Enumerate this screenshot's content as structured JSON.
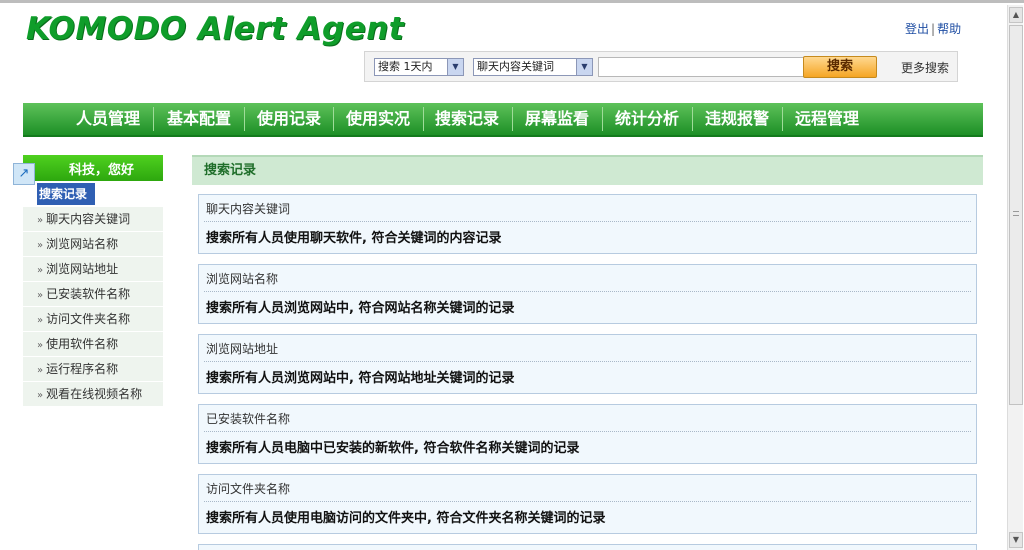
{
  "header": {
    "logo": "KOMODO Alert Agent",
    "links": [
      {
        "label": "登出"
      },
      {
        "label": "帮助"
      }
    ],
    "link_separator": "|"
  },
  "search": {
    "range_select": "搜索 1天内",
    "type_select": "聊天内容关键词",
    "keyword_value": "",
    "button_label": "搜索",
    "more_label": "更多搜索"
  },
  "nav": {
    "items": [
      {
        "label": "人员管理"
      },
      {
        "label": "基本配置"
      },
      {
        "label": "使用记录"
      },
      {
        "label": "使用实况"
      },
      {
        "label": "搜索记录"
      },
      {
        "label": "屏幕监看"
      },
      {
        "label": "统计分析"
      },
      {
        "label": "违规报警"
      },
      {
        "label": "远程管理"
      }
    ]
  },
  "sidebar": {
    "greeting": "科技，您好",
    "active": "搜索记录",
    "items": [
      {
        "label": "聊天内容关键词"
      },
      {
        "label": "浏览网站名称"
      },
      {
        "label": "浏览网站地址"
      },
      {
        "label": "已安装软件名称"
      },
      {
        "label": "访问文件夹名称"
      },
      {
        "label": "使用软件名称"
      },
      {
        "label": "运行程序名称"
      },
      {
        "label": "观看在线视频名称"
      }
    ]
  },
  "content": {
    "title": "搜索记录",
    "cards": [
      {
        "title": "聊天内容关键词",
        "desc": "搜索所有人员使用聊天软件, 符合关键词的内容记录"
      },
      {
        "title": "浏览网站名称",
        "desc": "搜索所有人员浏览网站中, 符合网站名称关键词的记录"
      },
      {
        "title": "浏览网站地址",
        "desc": "搜索所有人员浏览网站中, 符合网站地址关键词的记录"
      },
      {
        "title": "已安装软件名称",
        "desc": "搜索所有人员电脑中已安装的新软件, 符合软件名称关键词的记录"
      },
      {
        "title": "访问文件夹名称",
        "desc": "搜索所有人员使用电脑访问的文件夹中, 符合文件夹名称关键词的记录"
      }
    ]
  },
  "colors": {
    "brand_green": "#0f9d2a",
    "nav_green": "#1d8f26",
    "accent_orange": "#f5a524",
    "active_blue": "#2f5fb3"
  }
}
